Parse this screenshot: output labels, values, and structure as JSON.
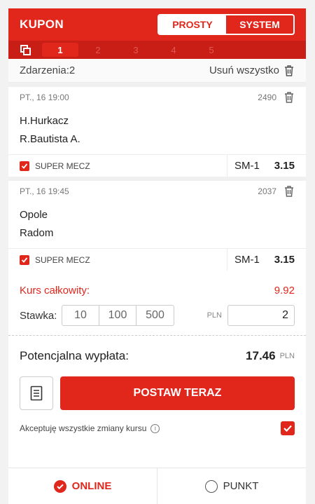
{
  "header": {
    "title": "KUPON",
    "toggle": [
      "PROSTY",
      "SYSTEM"
    ]
  },
  "tabs": [
    "1",
    "2",
    "3",
    "4",
    "5"
  ],
  "events_bar": {
    "label": "Zdarzenia:2",
    "clear": "Usuń wszystko"
  },
  "bets": [
    {
      "datetime": "PT., 16 19:00",
      "code": "2490",
      "team1": "H.Hurkacz",
      "team2": "R.Bautista A.",
      "super": "SUPER MECZ",
      "market": "SM-1",
      "odds": "3.15"
    },
    {
      "datetime": "PT., 16 19:45",
      "code": "2037",
      "team1": "Opole",
      "team2": "Radom",
      "super": "SUPER MECZ",
      "market": "SM-1",
      "odds": "3.15"
    }
  ],
  "summary": {
    "total_label": "Kurs całkowity:",
    "total_value": "9.92",
    "stake_label": "Stawka:",
    "quick": [
      "10",
      "100",
      "500"
    ],
    "currency": "PLN",
    "stake_value": "2"
  },
  "payout": {
    "label": "Potencjalna wypłata:",
    "value": "17.46",
    "currency": "PLN"
  },
  "actions": {
    "place": "POSTAW TERAZ"
  },
  "accept": {
    "label": "Akceptuję wszystkie zmiany kursu"
  },
  "footer": {
    "online": "ONLINE",
    "punkt": "PUNKT"
  },
  "colors": {
    "accent": "#e1261c",
    "tabs_bg": "#c81e16"
  }
}
